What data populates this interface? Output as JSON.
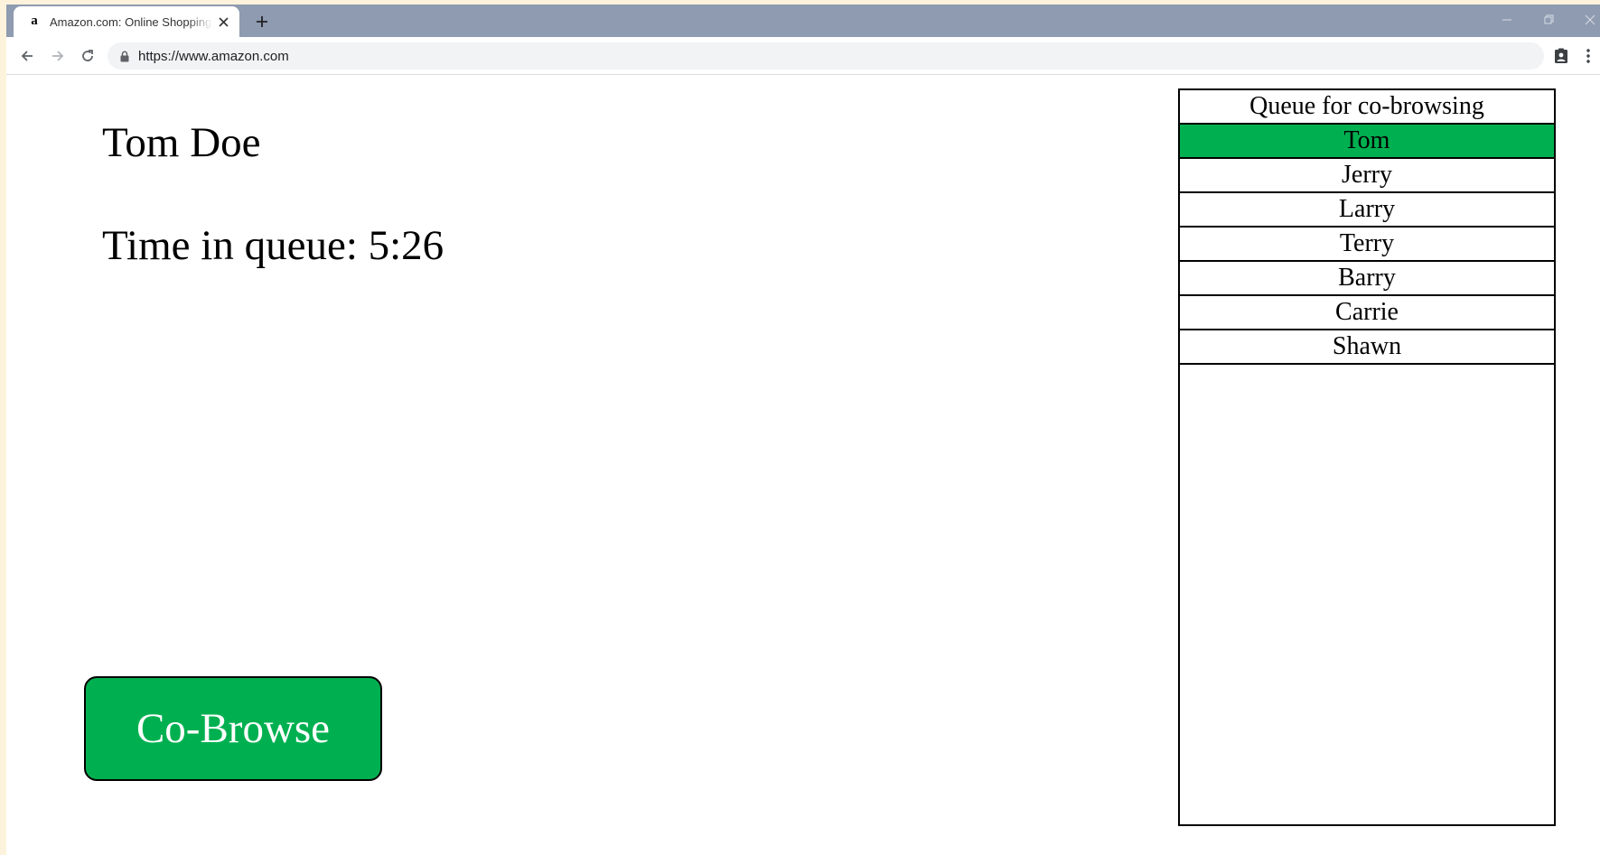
{
  "browser": {
    "tab_title": "Amazon.com: Online Shopping for Electronics",
    "favicon_letter": "a",
    "url": "https://www.amazon.com"
  },
  "agent_view": {
    "customer_name": "Tom Doe",
    "time_label": "Time in queue:",
    "time_value": "5:26",
    "cobrowse_label": "Co-Browse",
    "accent_color": "#00b050"
  },
  "queue": {
    "title": "Queue for co-browsing",
    "items": [
      {
        "name": "Tom",
        "active": true
      },
      {
        "name": "Jerry",
        "active": false
      },
      {
        "name": "Larry",
        "active": false
      },
      {
        "name": "Terry",
        "active": false
      },
      {
        "name": "Barry",
        "active": false
      },
      {
        "name": "Carrie",
        "active": false
      },
      {
        "name": "Shawn",
        "active": false
      }
    ]
  }
}
